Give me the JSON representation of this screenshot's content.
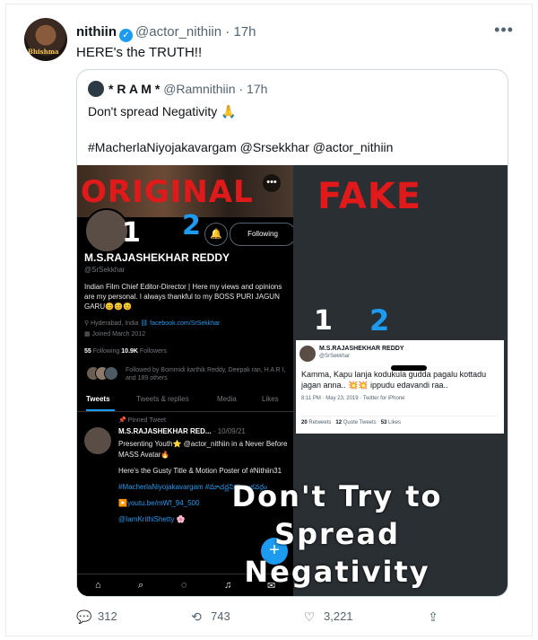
{
  "tweet": {
    "display_name": "nithiin",
    "handle": "@actor_nithiin",
    "time": "· 17h",
    "text": "HERE's the TRUTH!!",
    "avatar_text": "Bhishma",
    "more_label": "•••"
  },
  "quoted": {
    "display_name": "* R A M *",
    "handle": "@Ramnithiin",
    "time": "· 17h",
    "text_line1": "Don't spread Negativity 🙏",
    "text_line2": "#MacherlaNiyojakavargam @Srsekkhar @actor_nithiin"
  },
  "image": {
    "left_label": "ORIGINAL",
    "right_label": "FAKE",
    "marker_1": "1",
    "marker_2": "2",
    "original_profile": {
      "more": "•••",
      "bell": "🔔",
      "follow_button": "Following",
      "name": "M.S.RAJASHEKHAR REDDY",
      "handle": "@SrSekkhar",
      "bio": "Indian Film Chief Editor-Director | Here my views and opinions are my personal. I always thankful to my BOSS PURI JAGUN GARU😊😊😊",
      "location": "⚲ Hyderabad, India",
      "link": "⛓ facebook.com/SrSekkhar",
      "joined": "▦ Joined March 2012",
      "following_count": "55",
      "following_label": "Following",
      "followers_count": "10.9K",
      "followers_label": "Followers",
      "followed_by": "Followed by Bommidi karthik Reddy, Deepak ran, H A R I, and 189 others",
      "tabs": [
        "Tweets",
        "Tweets & replies",
        "Media",
        "Likes"
      ],
      "pinned_label": "📌 Pinned Tweet",
      "pinned_author": "M.S.RAJASHEKHAR RED...",
      "pinned_date": "· 10/09/21",
      "pinned_line1": "Presenting Youth⭐ @actor_nithiin in a Never Before MASS Avatar🔥",
      "pinned_line2": "Here's the Gusty Title & Motion Poster of #Nithiin31",
      "pinned_line3": "#MacherlaNiyojakavargam #మాచర్లనియోజకవర్గం",
      "pinned_line4": "▶️youtu.be/mWf_94_500",
      "pinned_line5": "@IamKrithiShetty 🌸"
    },
    "fake_tweet": {
      "name": "M.S.RAJASHEKHAR REDDY",
      "handle": "@SrSekkhar",
      "text": "Kamma, Kapu lanja kodukula gudda pagalu kottadu jagan anna.. 💥💥 ippudu edavandi raa..",
      "meta": "8:11 PM · May 23, 2019 · Twitter for iPhone",
      "retweets": "20",
      "retweets_label": "Retweets",
      "quotes": "12",
      "quotes_label": "Quote Tweets",
      "likes": "53",
      "likes_label": "Likes"
    },
    "overlay_line1": "Don't Try to",
    "overlay_line2": "Spread",
    "overlay_line3": "Negativity"
  },
  "actions": {
    "reply_count": "312",
    "retweet_count": "743",
    "like_count": "3,221"
  },
  "colors": {
    "accent": "#1d9bf0",
    "label_red": "#e0191b",
    "text_secondary": "#536471"
  }
}
